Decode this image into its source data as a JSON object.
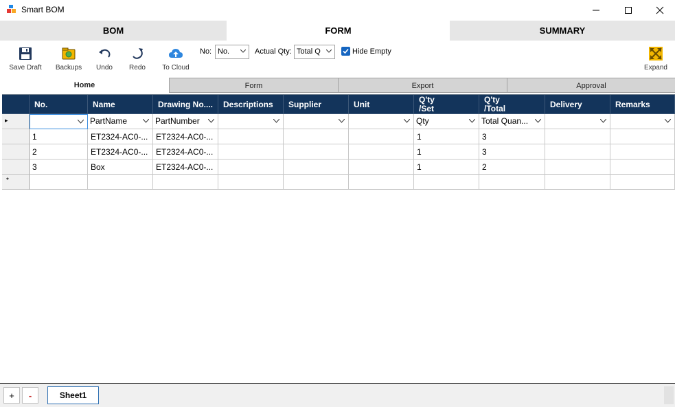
{
  "window": {
    "title": "Smart BOM"
  },
  "main_tabs": [
    {
      "label": "BOM",
      "active": false
    },
    {
      "label": "FORM",
      "active": true
    },
    {
      "label": "SUMMARY",
      "active": false
    }
  ],
  "toolbar": {
    "save_draft": "Save Draft",
    "backups": "Backups",
    "undo": "Undo",
    "redo": "Redo",
    "to_cloud": "To Cloud",
    "no_label": "No:",
    "no_value": "No.",
    "actual_qty_label": "Actual Qty:",
    "actual_qty_value": "Total Q",
    "hide_empty_label": "Hide Empty",
    "hide_empty_checked": true,
    "expand": "Expand"
  },
  "sub_tabs": [
    {
      "label": "Home",
      "active": true
    },
    {
      "label": "Form",
      "active": false
    },
    {
      "label": "Export",
      "active": false
    },
    {
      "label": "Approval",
      "active": false
    }
  ],
  "grid": {
    "headers": [
      "No.",
      "Name",
      "Drawing No....",
      "Descriptions",
      "Supplier",
      "Unit",
      "Q'ty\n/Set",
      "Q'ty\n/Total",
      "Delivery",
      "Remarks"
    ],
    "header_q_set": [
      "Q'ty",
      "/Set"
    ],
    "header_q_total": [
      "Q'ty",
      "/Total"
    ],
    "filters": [
      "",
      "PartName",
      "PartNumber",
      "",
      "",
      "",
      "Qty",
      "Total Quan...",
      "",
      ""
    ],
    "rows": [
      [
        "1",
        "ET2324-AC0-...",
        "ET2324-AC0-...",
        "",
        "",
        "",
        "1",
        "3",
        "",
        ""
      ],
      [
        "2",
        "ET2324-AC0-...",
        "ET2324-AC0-...",
        "",
        "",
        "",
        "1",
        "3",
        "",
        ""
      ],
      [
        "3",
        "Box",
        "ET2324-AC0-...",
        "",
        "",
        "",
        "1",
        "2",
        "",
        ""
      ]
    ],
    "new_row_marker": "*",
    "current_row_marker": "▸"
  },
  "bottom": {
    "add_label": "+",
    "remove_label": "-",
    "sheet_tab": "Sheet1"
  },
  "colors": {
    "header_bg": "#13345b",
    "accent": "#1565c0",
    "tab_inactive": "#e6e6e6"
  },
  "icons": {
    "app": "app-grid-icon",
    "save": "floppy-disk-icon",
    "backups": "backup-box-icon",
    "undo": "undo-arrow-icon",
    "redo": "redo-arrow-icon",
    "cloud": "cloud-upload-icon",
    "expand": "expand-arrows-icon"
  }
}
